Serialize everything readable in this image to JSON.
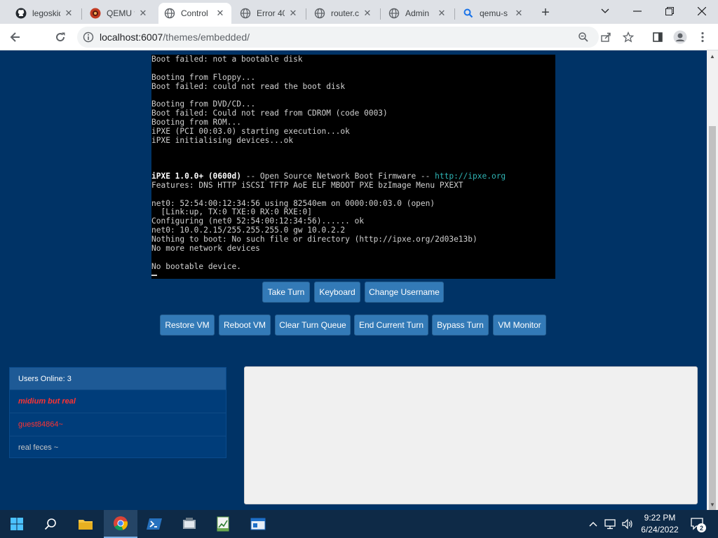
{
  "browser": {
    "tabs": [
      {
        "title": "legoskid",
        "icon": "github-icon"
      },
      {
        "title": "QEMU f",
        "icon": "qemu-icon"
      },
      {
        "title": "Control",
        "icon": "globe-icon",
        "active": true
      },
      {
        "title": "Error 40",
        "icon": "globe-icon"
      },
      {
        "title": "router.c",
        "icon": "globe-icon"
      },
      {
        "title": "Admin",
        "icon": "globe-icon"
      },
      {
        "title": "qemu-s",
        "icon": "search-icon"
      }
    ],
    "url_host": "localhost:6007",
    "url_path": "/themes/embedded/"
  },
  "vm_screen": {
    "lines": [
      "Boot failed: not a bootable disk",
      "",
      "Booting from Floppy...",
      "Boot failed: could not read the boot disk",
      "",
      "Booting from DVD/CD...",
      "Boot failed: Could not read from CDROM (code 0003)",
      "Booting from ROM...",
      "iPXE (PCI 00:03.0) starting execution...ok",
      "iPXE initialising devices...ok",
      "",
      "",
      "iPXE 1.0.0+ (0600d) -- Open Source Network Boot Firmware -- http://ipxe.org",
      "Features: DNS HTTP iSCSI TFTP AoE ELF MBOOT PXE bzImage Menu PXEXT",
      "",
      "net0: 52:54:00:12:34:56 using 82540em on 0000:00:03.0 (open)",
      "  [Link:up, TX:0 TXE:0 RX:0 RXE:0]",
      "Configuring (net0 52:54:00:12:34:56)...... ok",
      "net0: 10.0.2.15/255.255.255.0 gw 10.0.2.2",
      "Nothing to boot: No such file or directory (http://ipxe.org/2d03e13b)",
      "No more network devices",
      "",
      "No bootable device."
    ],
    "ipxe_banner": "iPXE 1.0.0+ (0600d)",
    "ipxe_banner_rest": " -- Open Source Network Boot Firmware -- ",
    "ipxe_link": "http://ipxe.org"
  },
  "controls": {
    "take_turn": "Take Turn",
    "keyboard": "Keyboard",
    "change_username": "Change Username",
    "restore_vm": "Restore VM",
    "reboot_vm": "Reboot VM",
    "clear_turn_queue": "Clear Turn Queue",
    "end_current_turn": "End Current Turn",
    "bypass_turn": "Bypass Turn",
    "vm_monitor": "VM Monitor"
  },
  "users": {
    "header": "Users Online: 3",
    "list": [
      "midium but real",
      "guest84864~",
      "real feces ~"
    ]
  },
  "taskbar": {
    "time": "9:22 PM",
    "date": "6/24/2022",
    "notifications": "2"
  },
  "colors": {
    "page_bg": "#003366",
    "button": "#337ab7",
    "user_highlight": "#ff3333"
  }
}
